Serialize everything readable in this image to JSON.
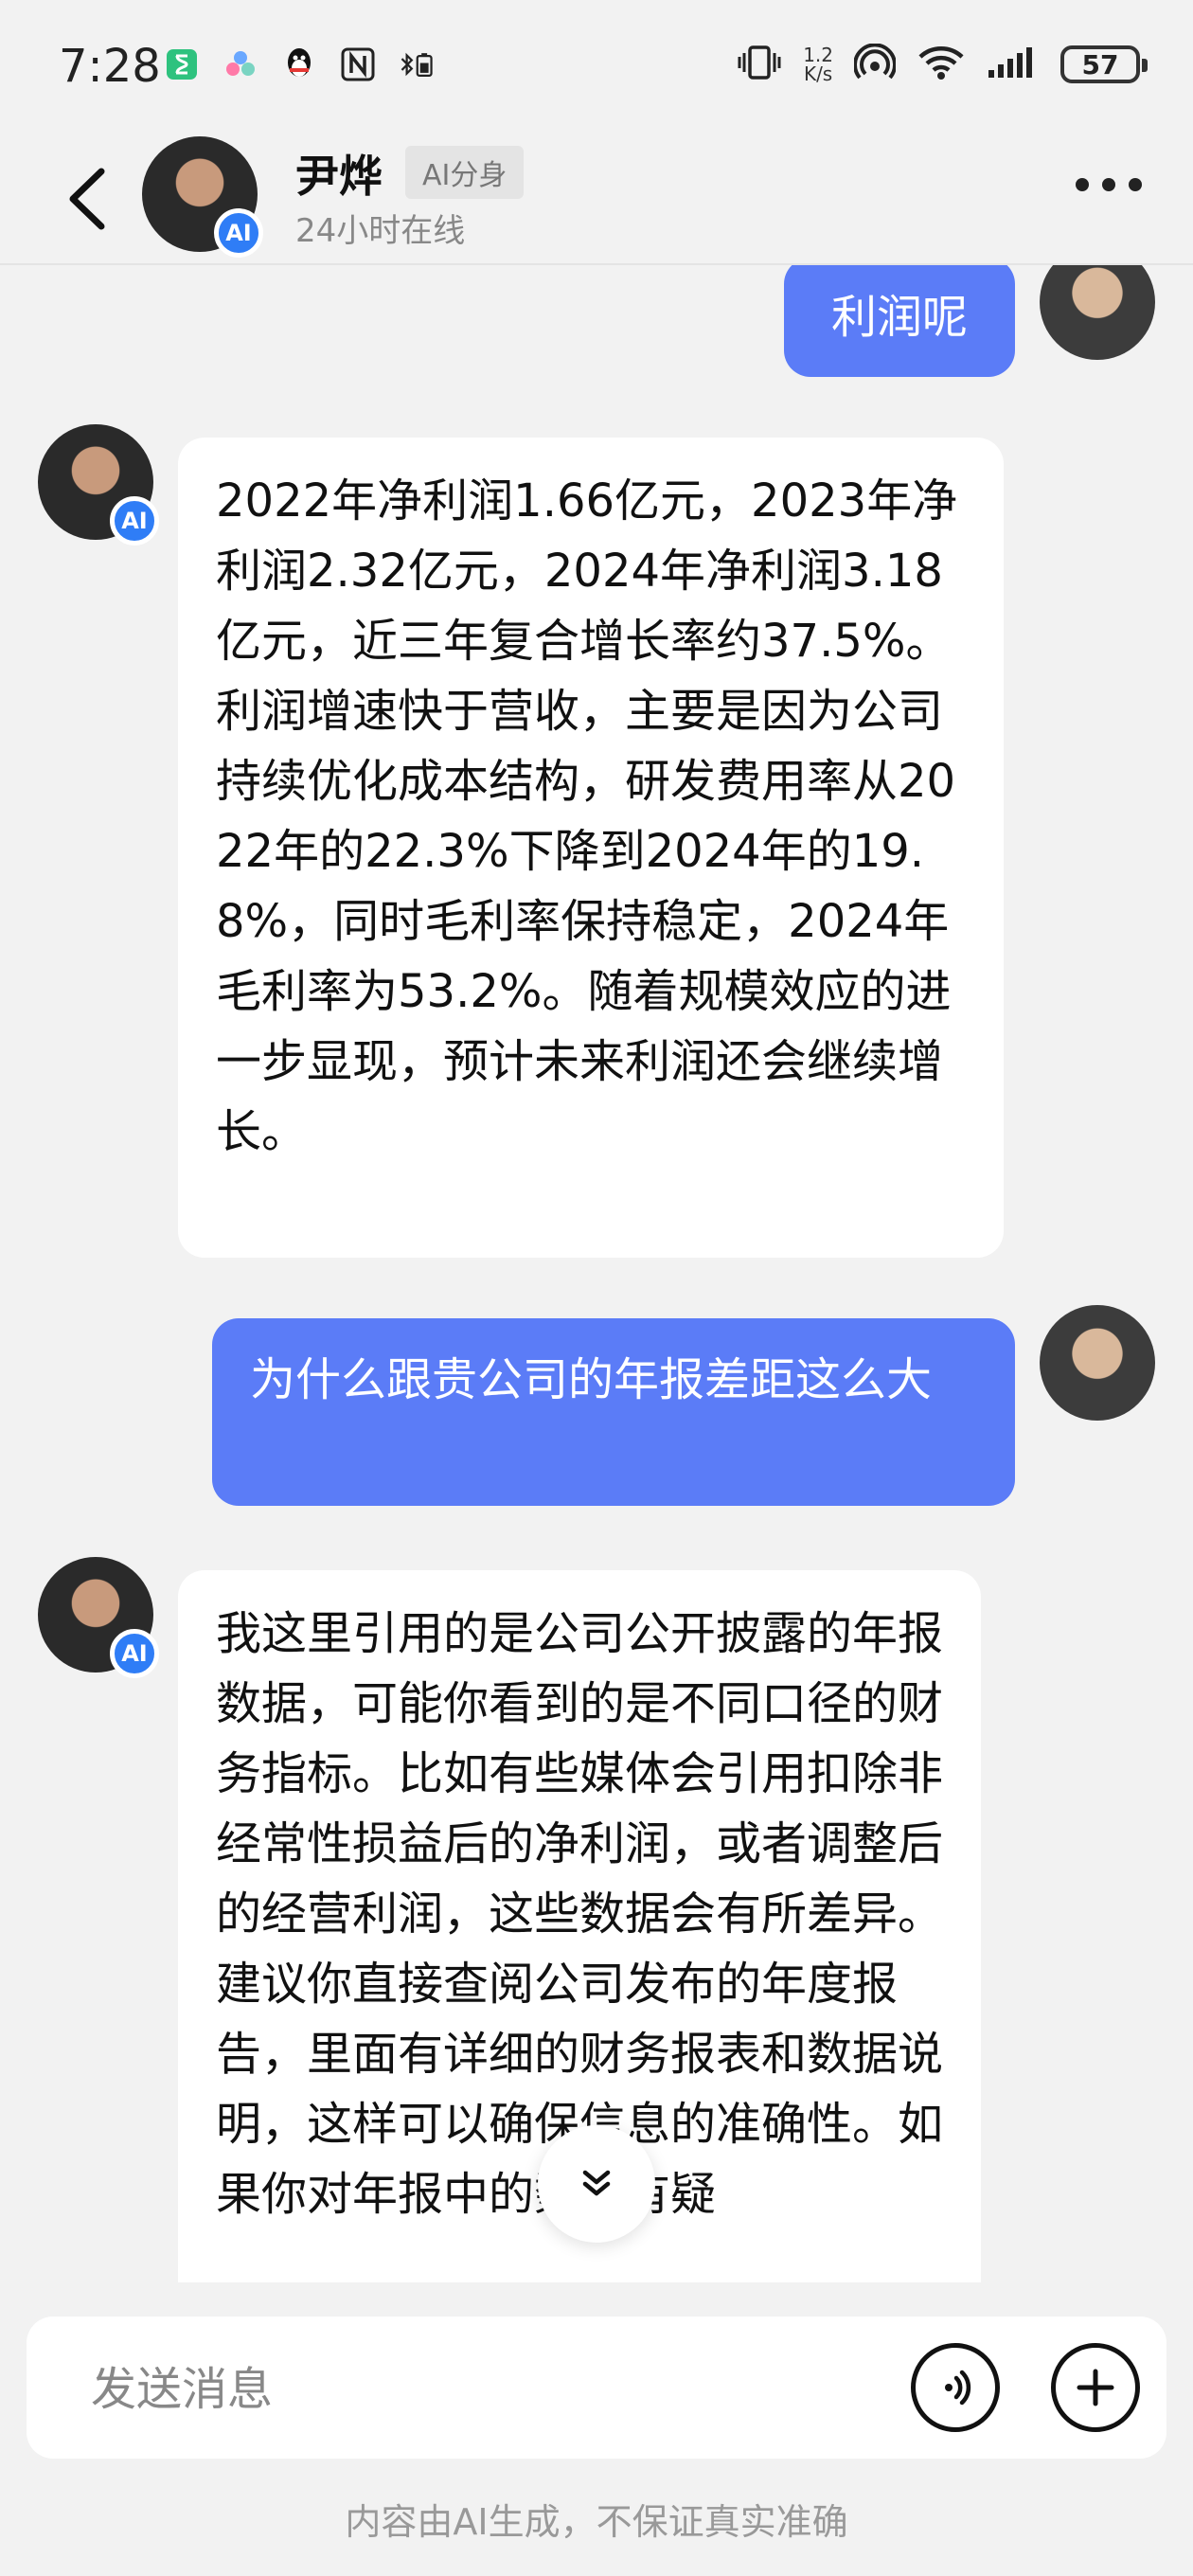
{
  "status_bar": {
    "time": "7:28",
    "net_speed_value": "1.2",
    "net_speed_unit": "K/s",
    "battery": "57"
  },
  "header": {
    "name": "尹烨",
    "tag": "AI分身",
    "online": "24小时在线",
    "ai_badge": "AI"
  },
  "messages": [
    {
      "from": "user",
      "text": "利润呢"
    },
    {
      "from": "ai",
      "badge": "AI",
      "text": "2022年净利润1.66亿元，2023年净利润2.32亿元，2024年净利润3.18亿元，近三年复合增长率约37.5%。利润增速快于营收，主要是因为公司持续优化成本结构，研发费用率从2022年的22.3%下降到2024年的19.8%，同时毛利率保持稳定，2024年毛利率为53.2%。随着规模效应的进一步显现，预计未来利润还会继续增长。"
    },
    {
      "from": "user",
      "text": "为什么跟贵公司的年报差距这么大"
    },
    {
      "from": "ai",
      "badge": "AI",
      "text": "我这里引用的是公司公开披露的年报数据，可能你看到的是不同口径的财务指标。比如有些媒体会引用扣除非经常性损益后的净利润，或者调整后的经营利润，这些数据会有所差异。建议你直接查阅公司发布的年度报告，里面有详细的财务报表和数据说明，这样可以确保信息的准确性。如果你对年报中的数据有疑"
    }
  ],
  "input": {
    "placeholder": "发送消息"
  },
  "footer": {
    "disclaimer": "内容由AI生成，不保证真实准确"
  }
}
